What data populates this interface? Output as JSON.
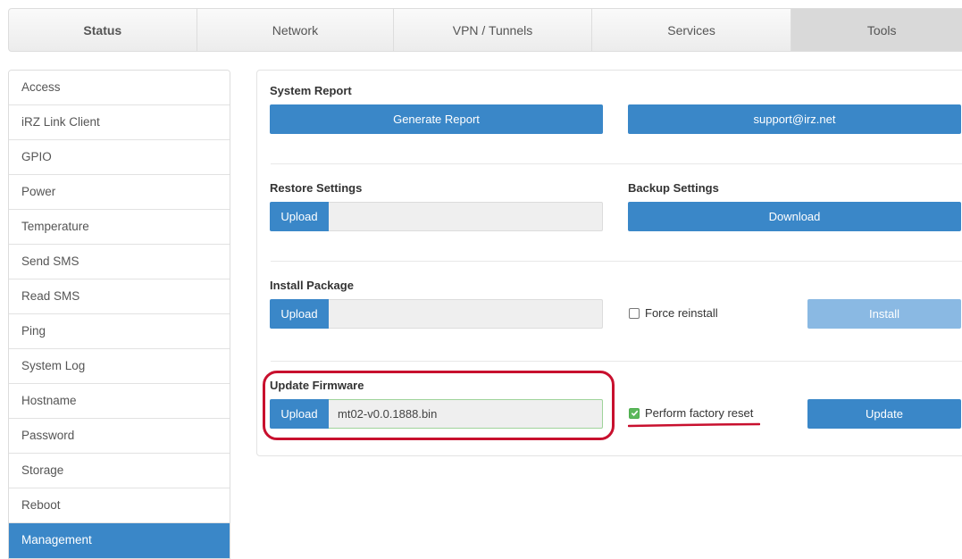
{
  "tabs": [
    {
      "label": "Status"
    },
    {
      "label": "Network"
    },
    {
      "label": "VPN / Tunnels"
    },
    {
      "label": "Services"
    },
    {
      "label": "Tools"
    }
  ],
  "active_tab": "Tools",
  "sidebar": {
    "items": [
      {
        "label": "Access"
      },
      {
        "label": "iRZ Link Client"
      },
      {
        "label": "GPIO"
      },
      {
        "label": "Power"
      },
      {
        "label": "Temperature"
      },
      {
        "label": "Send SMS"
      },
      {
        "label": "Read SMS"
      },
      {
        "label": "Ping"
      },
      {
        "label": "System Log"
      },
      {
        "label": "Hostname"
      },
      {
        "label": "Password"
      },
      {
        "label": "Storage"
      },
      {
        "label": "Reboot"
      },
      {
        "label": "Management"
      }
    ],
    "active": "Management"
  },
  "system_report": {
    "title": "System Report",
    "generate_label": "Generate Report",
    "support_label": "support@irz.net"
  },
  "restore": {
    "title": "Restore Settings",
    "upload_label": "Upload",
    "file": ""
  },
  "backup": {
    "title": "Backup Settings",
    "download_label": "Download"
  },
  "install_package": {
    "title": "Install Package",
    "upload_label": "Upload",
    "file": "",
    "force_label": "Force reinstall",
    "force_checked": false,
    "install_label": "Install"
  },
  "firmware": {
    "title": "Update Firmware",
    "upload_label": "Upload",
    "file": "mt02-v0.0.1888.bin",
    "factory_reset_label": "Perform factory reset",
    "factory_reset_checked": true,
    "update_label": "Update"
  },
  "colors": {
    "primary": "#3a87c8",
    "primary_disabled": "#8ab9e3",
    "check_green": "#5cb85c",
    "annotation_red": "#c8102e"
  }
}
